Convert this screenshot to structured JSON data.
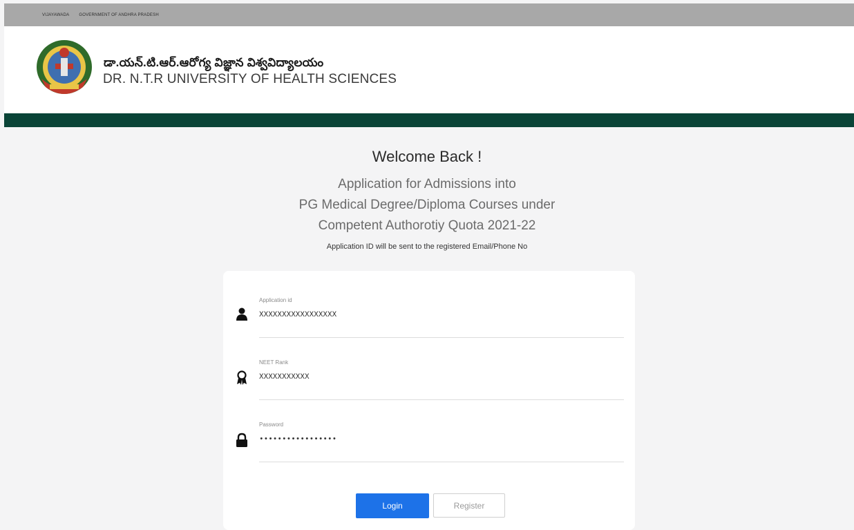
{
  "topbar": {
    "city": "VIJAYAWADA",
    "govt": "GOVERNMENT OF ANDHRA PRADESH"
  },
  "header": {
    "title_telugu": "డా.యన్.టి.ఆర్.ఆరోగ్య విజ్ఞాన విశ్వవిద్యాలయం",
    "title_english": "DR. N.T.R UNIVERSITY OF HEALTH SCIENCES"
  },
  "main": {
    "welcome": "Welcome Back !",
    "subtitle_line1": "Application for Admissions into",
    "subtitle_line2": "PG Medical Degree/Diploma Courses under",
    "subtitle_line3": "Competent Authorotiy Quota 2021-22",
    "note": "Application ID will be sent to the registered Email/Phone No"
  },
  "form": {
    "application_id": {
      "label": "Application id",
      "value": "XXXXXXXXXXXXXXXXX",
      "icon": "user-icon"
    },
    "neet_rank": {
      "label": "NEET Rank",
      "value": "XXXXXXXXXXX",
      "icon": "award-icon"
    },
    "password": {
      "label": "Password",
      "value": "•••••••••••••••••",
      "icon": "lock-icon"
    },
    "login_label": "Login",
    "register_label": "Register"
  },
  "colors": {
    "accent_green": "#0a4437",
    "login_blue": "#1d72e8",
    "topbar_gray": "#a8a8a8"
  }
}
